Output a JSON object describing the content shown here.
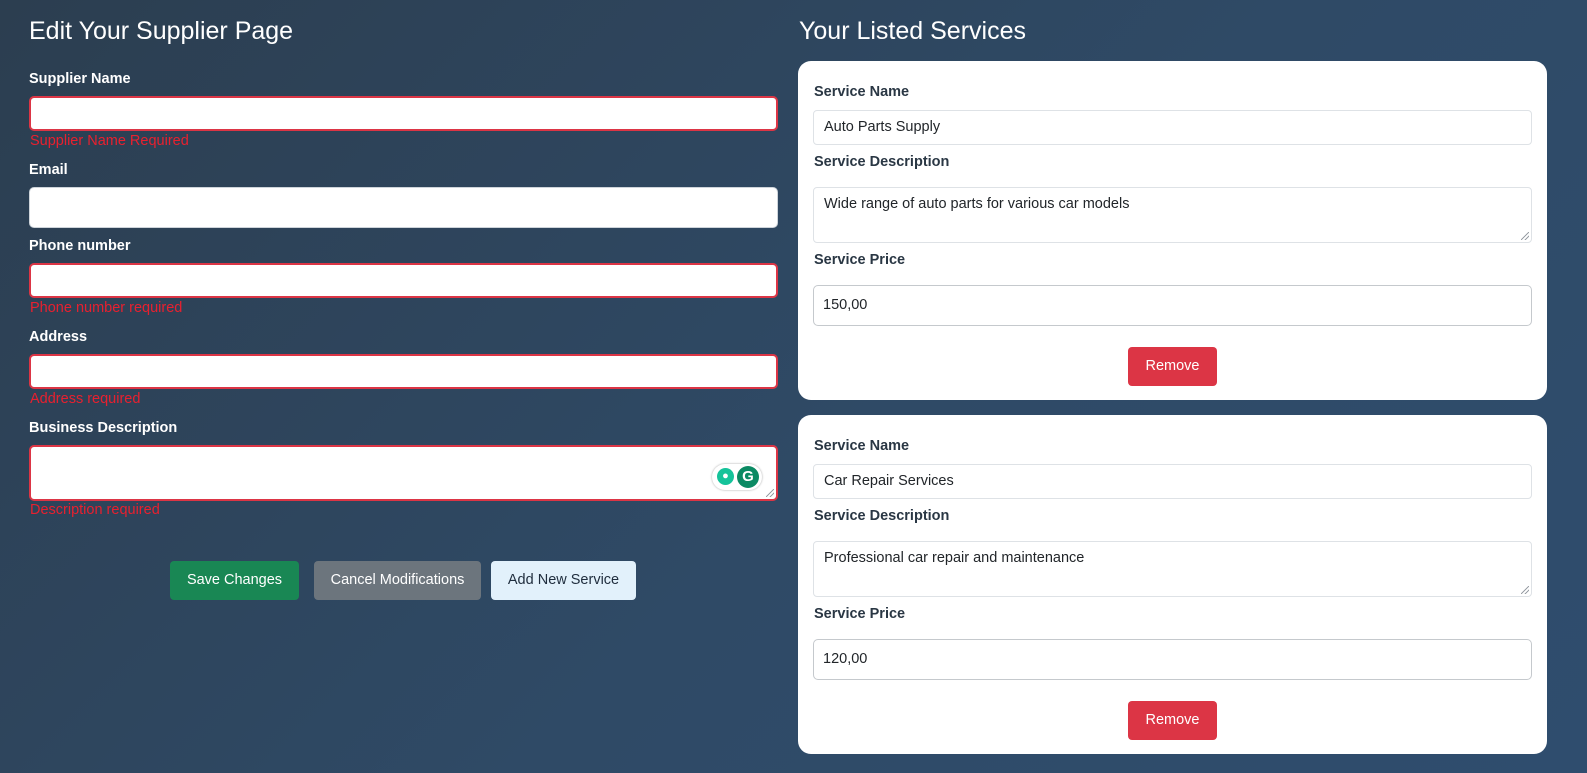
{
  "edit_form": {
    "title": "Edit Your Supplier Page",
    "supplier_name": {
      "label": "Supplier Name",
      "value": "",
      "error": "Supplier Name Required"
    },
    "email": {
      "label": "Email",
      "value": ""
    },
    "phone": {
      "label": "Phone number",
      "value": "",
      "error": "Phone number required"
    },
    "address": {
      "label": "Address",
      "value": "",
      "error": "Address required"
    },
    "description": {
      "label": "Business Description",
      "value": "",
      "error": "Description required"
    },
    "buttons": {
      "save": "Save Changes",
      "cancel": "Cancel Modifications",
      "add_service": "Add New Service"
    }
  },
  "services": {
    "title": "Your Listed Services",
    "items": [
      {
        "name_label": "Service Name",
        "name": "Auto Parts Supply",
        "description_label": "Service Description",
        "description": "Wide range of auto parts for various car models",
        "price_label": "Service Price",
        "price": "150,00",
        "remove_label": "Remove"
      },
      {
        "name_label": "Service Name",
        "name": "Car Repair Services",
        "description_label": "Service Description",
        "description": "Professional car repair and maintenance",
        "price_label": "Service Price",
        "price": "120,00",
        "remove_label": "Remove"
      }
    ]
  },
  "colors": {
    "background": "#2c3e50",
    "error": "#dc3545",
    "save": "#198754",
    "cancel": "#6c757d",
    "add": "#e2f1fb",
    "remove": "#dc3545"
  },
  "icons": {
    "grammarly_bulb": "grammarly-suggestion-icon",
    "grammarly_logo": "grammarly-logo-icon"
  }
}
